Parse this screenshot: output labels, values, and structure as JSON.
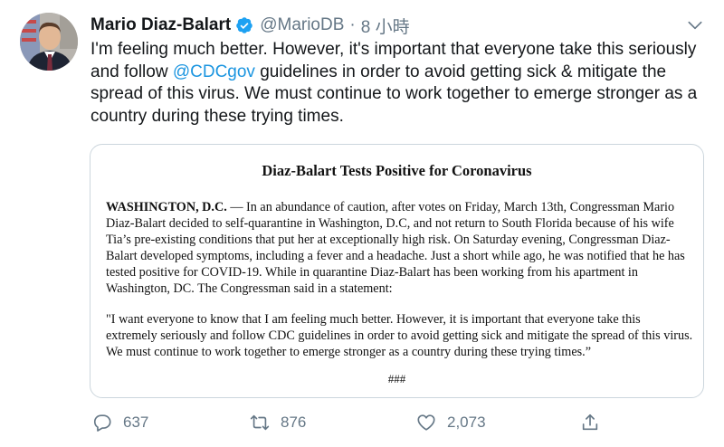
{
  "author": {
    "name": "Mario Diaz-Balart",
    "handle": "@MarioDB",
    "separator": "·",
    "time": "8 小時"
  },
  "tweet": {
    "text_before": "I'm feeling much better.  However, it's important that everyone take this seriously and follow ",
    "mention": "@CDCgov",
    "text_after": " guidelines in order to avoid getting sick & mitigate the spread of this virus. We must continue to work together to emerge stronger as a country during these trying times."
  },
  "card": {
    "title": "Diaz-Balart Tests Positive for Coronavirus",
    "dateline": "WASHINGTON, D.C.",
    "paragraph1": " — In an abundance of caution, after votes on Friday, March 13th, Congressman Mario Diaz-Balart decided to self-quarantine in Washington, D.C, and not return to South Florida because of his wife Tia’s pre-existing conditions that put her at exceptionally high risk.  On Saturday evening, Congressman Diaz-Balart developed symptoms, including a fever and a headache.  Just a short while ago, he was notified that he has tested positive for COVID-19. While in quarantine Diaz-Balart has been working from his apartment in Washington, DC. The Congressman said in a statement:",
    "quote": "\"I want everyone to know that I am feeling much better.  However, it is important that everyone take this extremely seriously and follow CDC guidelines in order to avoid getting sick and mitigate the spread of this virus.  We must continue to work together to emerge stronger as a country during these trying times.”",
    "end_mark": "###"
  },
  "actions": {
    "replies": "637",
    "retweets": "876",
    "likes": "2,073"
  },
  "colors": {
    "text": "#14171a",
    "secondary": "#657786",
    "link": "#1b95e0",
    "verified": "#1da1f2",
    "border": "#ccd6dd"
  },
  "icons": {
    "verified": "verified-badge-icon",
    "caret": "chevron-down-icon",
    "reply": "reply-icon",
    "retweet": "retweet-icon",
    "like": "heart-icon",
    "share": "share-icon"
  }
}
